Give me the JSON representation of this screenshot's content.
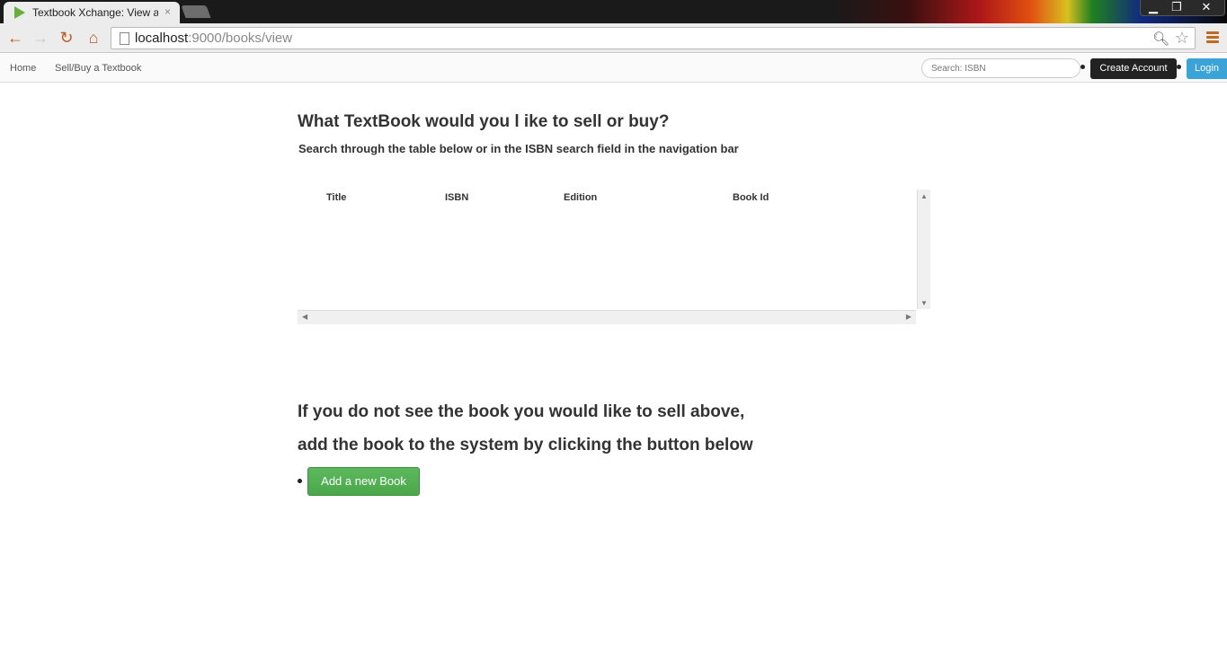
{
  "browser": {
    "tab_title": "Textbook Xchange: View a",
    "tab_close": "×",
    "url_host": "localhost",
    "url_rest": ":9000/books/view",
    "window_controls": {
      "minimize": "▁",
      "restore": "❐",
      "close": "✕"
    },
    "icons": {
      "back": "arrow-left-icon",
      "forward": "arrow-right-icon",
      "reload": "reload-icon",
      "home": "home-icon",
      "search": "magnifier-icon",
      "bookmark": "star-icon",
      "menu": "menu-icon"
    }
  },
  "navbar": {
    "links": [
      "Home",
      "Sell/Buy a Textbook"
    ],
    "search_placeholder": "Search: ISBN",
    "create_account": "Create Account",
    "login": "Login",
    "login_color": "#3aa3d8"
  },
  "main": {
    "heading": "What TextBook would you l ike to sell or buy?",
    "subtext": "Search through the table below or in the ISBN search field in the navigation bar",
    "table": {
      "columns": [
        "Title",
        "ISBN",
        "Edition",
        "Book Id"
      ],
      "rows": []
    },
    "prompt_line1": "If you do not see the book you would like to sell above,",
    "prompt_line2": "add the book to the system by clicking the button below",
    "add_button": "Add a new Book",
    "add_button_color": "#5cb85c"
  }
}
